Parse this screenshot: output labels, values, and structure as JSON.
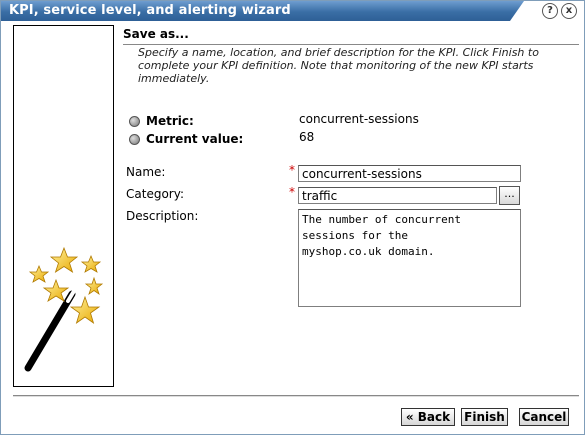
{
  "window": {
    "title": "KPI, service level, and alerting wizard",
    "help_glyph": "?",
    "close_glyph": "x"
  },
  "section": {
    "title": "Save as...",
    "intro": "Specify a name, location, and brief description for the KPI. Click Finish to complete your KPI definition. Note that monitoring of the new KPI starts immediately."
  },
  "info": {
    "metric_label": "Metric:",
    "metric_value": "concurrent-sessions",
    "current_label": "Current value:",
    "current_value": "68"
  },
  "form": {
    "name_label": "Name:",
    "name_value": "concurrent-sessions",
    "category_label": "Category:",
    "category_value": "traffic",
    "browse_label": "...",
    "description_label": "Description:",
    "description_value": "The number of concurrent\nsessions for the\nmyshop.co.uk domain.",
    "required_marker": "*"
  },
  "buttons": {
    "back": "« Back",
    "finish": "Finish",
    "cancel": "Cancel"
  },
  "icons": {
    "side_image": "magic-wand-stars-icon",
    "help": "help-icon",
    "close": "close-icon",
    "bullet": "bullet-icon"
  },
  "colors": {
    "titlebar": "#3a6ea5",
    "star": "#f5c518",
    "required": "#cc0000"
  }
}
